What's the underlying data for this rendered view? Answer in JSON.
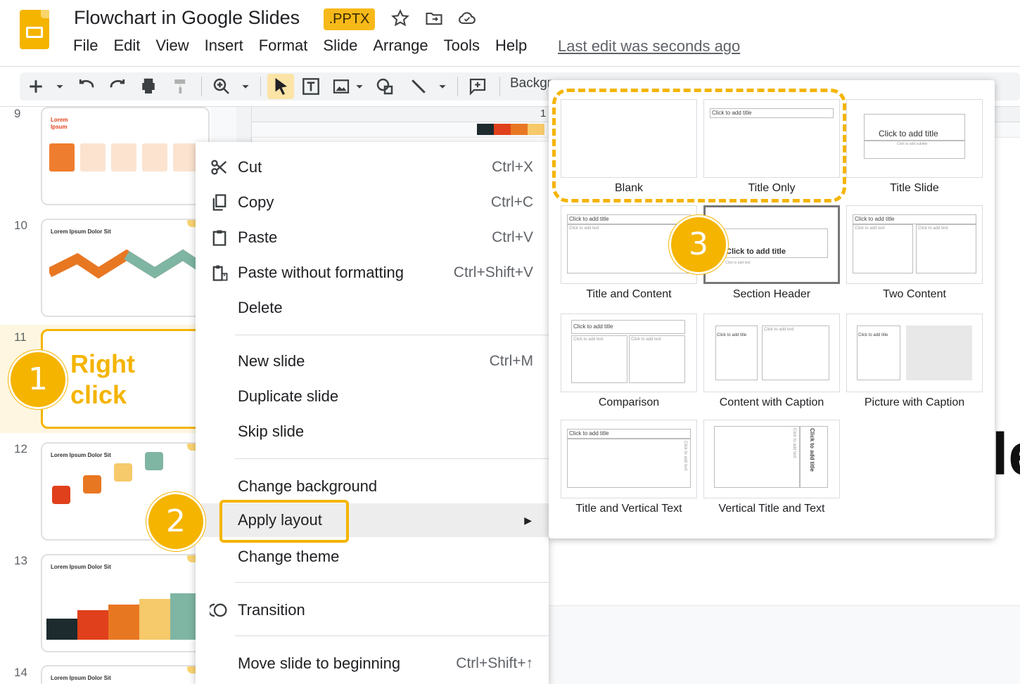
{
  "header": {
    "doc_title": "Flowchart in Google Slides",
    "file_badge": ".PPTX",
    "menu": [
      "File",
      "Edit",
      "View",
      "Insert",
      "Format",
      "Slide",
      "Arrange",
      "Tools",
      "Help"
    ],
    "last_edit": "Last edit was seconds ago"
  },
  "toolbar": {
    "background_label": "Backgr"
  },
  "filmstrip": {
    "slides": [
      {
        "number": "9",
        "title": "Lorem Ipsum"
      },
      {
        "number": "10",
        "title": "Lorem Ipsum Dolor Sit"
      },
      {
        "number": "11",
        "title": ""
      },
      {
        "number": "12",
        "title": "Lorem Ipsum Dolor Sit"
      },
      {
        "number": "13",
        "title": "Lorem Ipsum Dolor Sit"
      },
      {
        "number": "14",
        "title": "Lorem Ipsum Dolor Sit"
      }
    ]
  },
  "canvas": {
    "swatch_colors": [
      "#1d2b2e",
      "#e0401b",
      "#e87722",
      "#f6c96a"
    ],
    "partial_text": "le",
    "ruler_mark": "1"
  },
  "context_menu": {
    "items": [
      {
        "label": "Cut",
        "shortcut": "Ctrl+X",
        "icon": "scissors-icon"
      },
      {
        "label": "Copy",
        "shortcut": "Ctrl+C",
        "icon": "copy-icon"
      },
      {
        "label": "Paste",
        "shortcut": "Ctrl+V",
        "icon": "clipboard-icon"
      },
      {
        "label": "Paste without formatting",
        "shortcut": "Ctrl+Shift+V",
        "icon": "paste-plain-icon"
      },
      {
        "label": "Delete",
        "shortcut": ""
      },
      {
        "label": "New slide",
        "shortcut": "Ctrl+M"
      },
      {
        "label": "Duplicate slide",
        "shortcut": ""
      },
      {
        "label": "Skip slide",
        "shortcut": ""
      },
      {
        "label": "Change background",
        "shortcut": ""
      },
      {
        "label": "Apply layout",
        "shortcut": ""
      },
      {
        "label": "Change theme",
        "shortcut": ""
      },
      {
        "label": "Transition",
        "shortcut": "",
        "icon": "transition-icon"
      },
      {
        "label": "Move slide to beginning",
        "shortcut": "Ctrl+Shift+↑"
      }
    ]
  },
  "layouts": {
    "items": [
      {
        "label": "Blank"
      },
      {
        "label": "Title Only"
      },
      {
        "label": "Title Slide"
      },
      {
        "label": "Title and Content"
      },
      {
        "label": "Section Header"
      },
      {
        "label": "Two Content"
      },
      {
        "label": "Comparison"
      },
      {
        "label": "Content with Caption"
      },
      {
        "label": "Picture with Caption"
      },
      {
        "label": "Title and Vertical Text"
      },
      {
        "label": "Vertical Title and Text"
      }
    ],
    "preview_text": {
      "add_title": "Click to add title",
      "add_text": "Click to add text",
      "add_subtitle": "Click to add subtitle"
    }
  },
  "annotations": {
    "step1": "1",
    "step2": "2",
    "step3": "3",
    "right_click": "Right click",
    "accent_color": "#f4b400"
  }
}
